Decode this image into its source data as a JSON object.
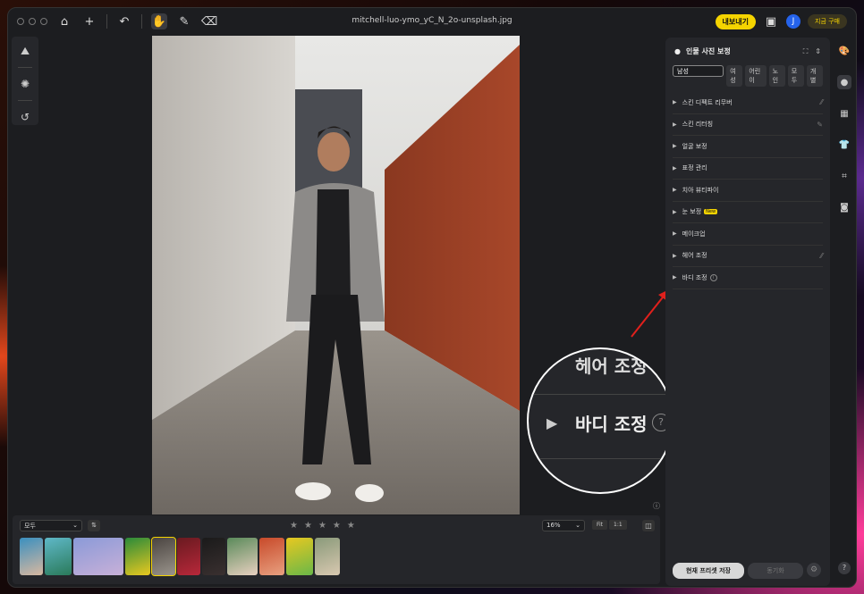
{
  "titlebar": {
    "filename": "mitchell-luo-ymo_yC_N_2o-unsplash.jpg",
    "export_label": "내보내기",
    "avatar_initial": "J",
    "buy_label": "지금 구매",
    "icons": [
      "home-icon",
      "plus-icon",
      "undo-icon",
      "hand-icon",
      "brush-icon",
      "eraser-icon"
    ]
  },
  "panel": {
    "title": "인물 사진 보정",
    "chips": [
      "남성",
      "여성",
      "어린이",
      "노인",
      "모두",
      "개별"
    ],
    "selected_chip": "남성",
    "items": [
      {
        "label": "스킨 디펙트 리무버",
        "suffix": "⁄⁄"
      },
      {
        "label": "스킨 리터칭",
        "suffix": "✎"
      },
      {
        "label": "얼굴 보정",
        "suffix": ""
      },
      {
        "label": "표정 관리",
        "suffix": ""
      },
      {
        "label": "치아 뷰티파이",
        "suffix": ""
      },
      {
        "label": "눈 보정",
        "badge": "New",
        "suffix": ""
      },
      {
        "label": "메이크업",
        "suffix": ""
      },
      {
        "label": "헤어 조정",
        "suffix": "⁄⁄"
      },
      {
        "label": "바디 조정",
        "info": "i",
        "suffix": ""
      }
    ],
    "save_preset_label": "현재 프리셋 저장",
    "sync_label": "동기화"
  },
  "zoom_callout": {
    "upper_text": "헤어 조정",
    "main_text": "바디 조정",
    "info": "?"
  },
  "bottom": {
    "filter_value": "모두",
    "sort_label": "⇅",
    "zoom_value": "16%",
    "fit_label": "Fit",
    "one_to_one_label": "1:1",
    "rating_stars": 0
  },
  "colors": {
    "accent": "#f5d400",
    "panel": "#25262a",
    "window": "#1c1d20",
    "highlight_arrow": "#e0201c"
  }
}
